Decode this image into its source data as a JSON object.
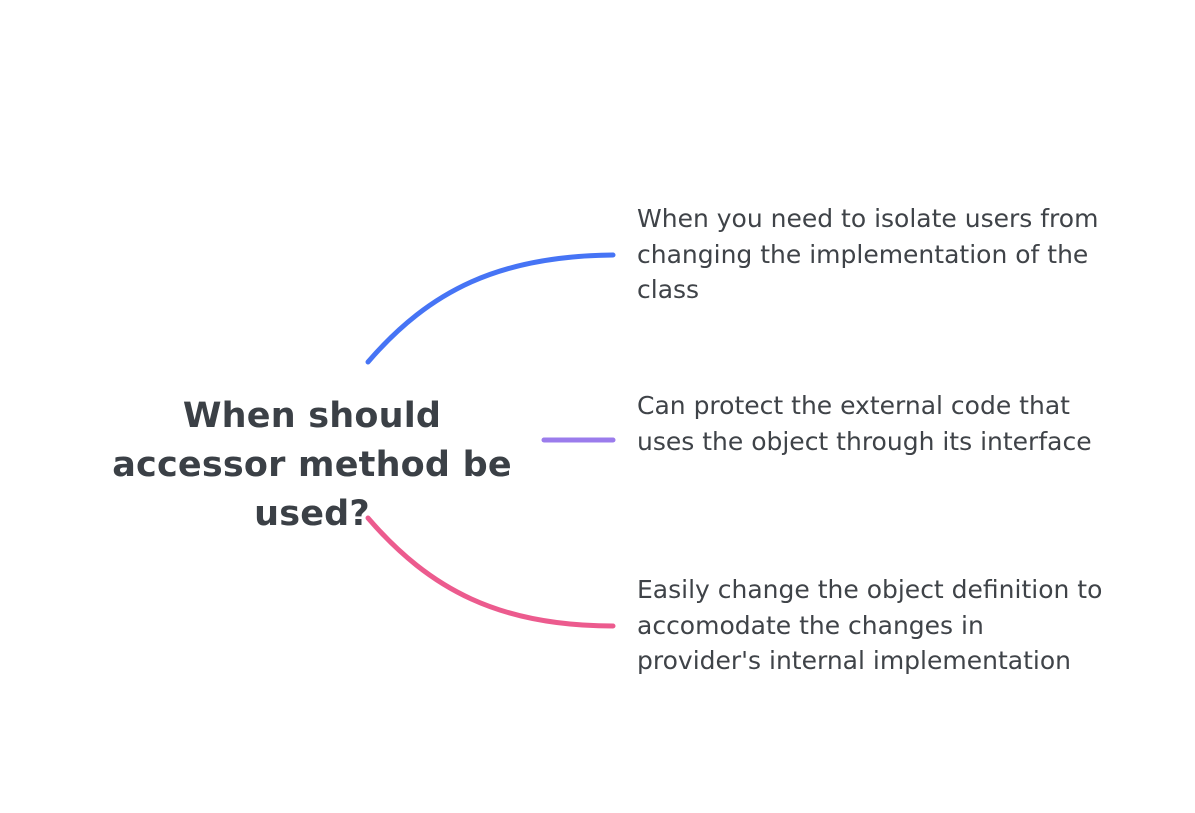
{
  "central_topic": "When should accessor method be used?",
  "branches": [
    {
      "text": "When you need to isolate users from changing the implementation of the class",
      "color": "#4674f5"
    },
    {
      "text": "Can protect the external code that uses the object through its interface",
      "color": "#9b7cec"
    },
    {
      "text": "Easily change the object definition to accomodate the changes in provider's internal implementation",
      "color": "#ec5b8e"
    }
  ]
}
